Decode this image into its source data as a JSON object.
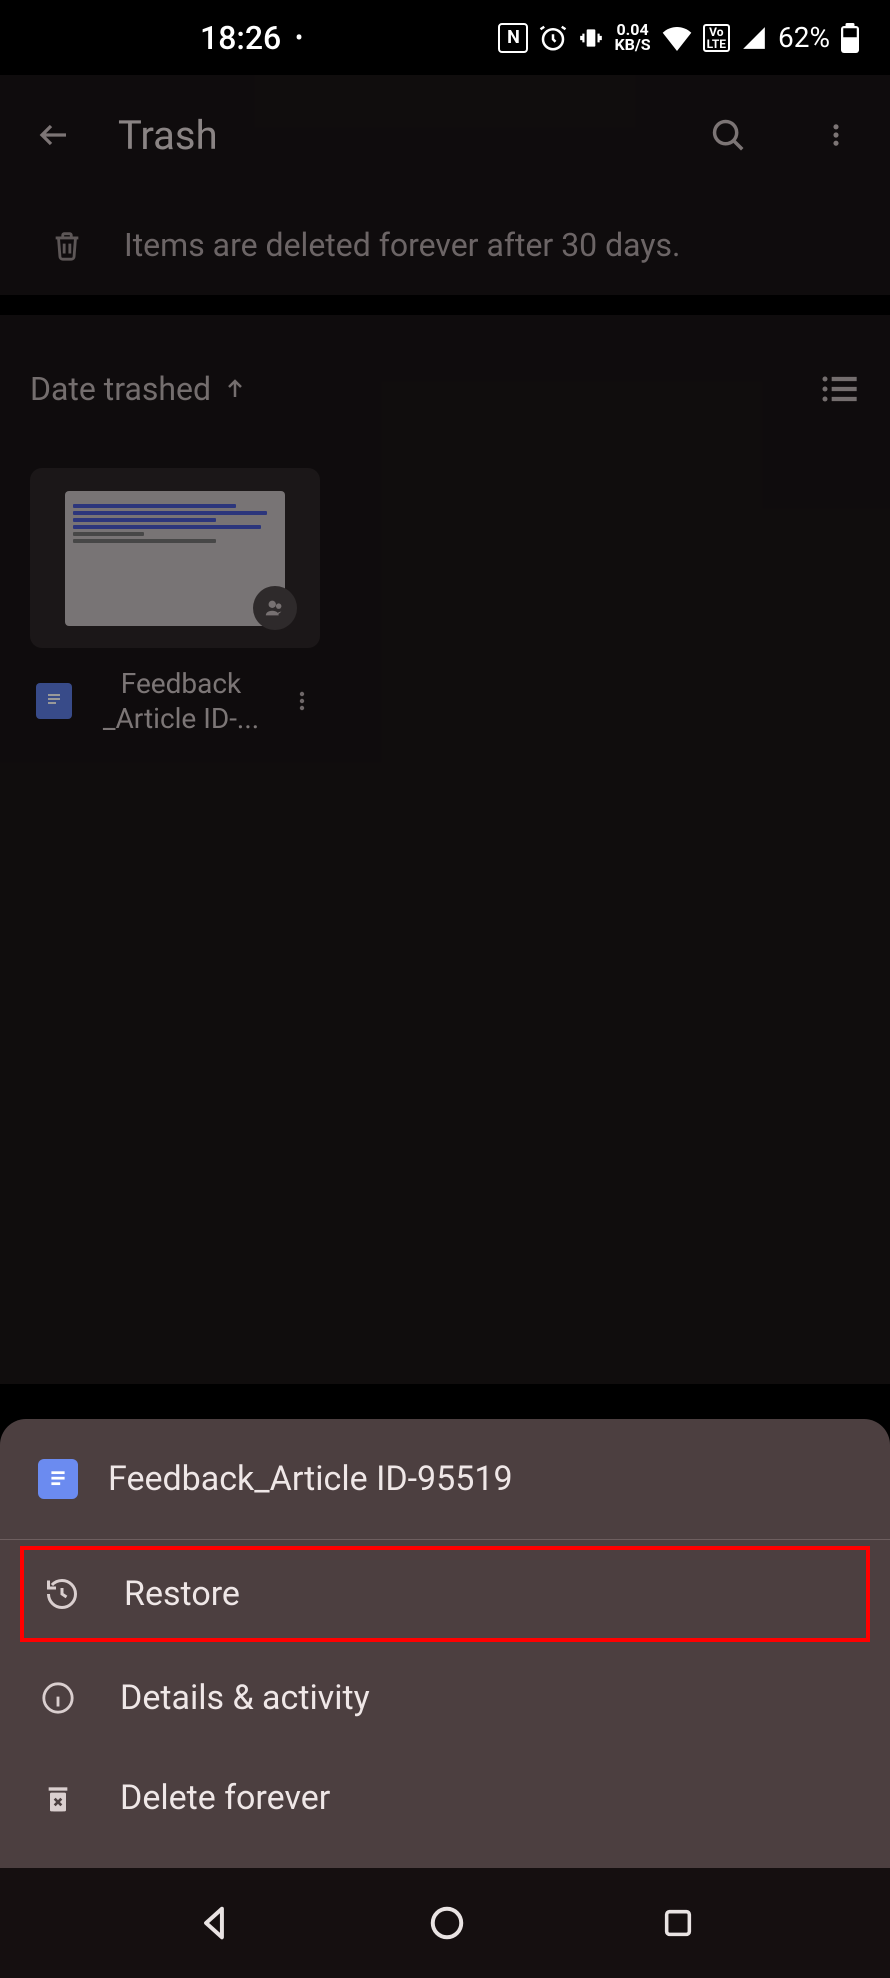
{
  "status": {
    "time": "18:26",
    "nfc_icon": "NFC",
    "data_rate_top": "0.04",
    "data_rate_bottom": "KB/S",
    "volte": "Vo LTE",
    "battery_pct": "62%"
  },
  "header": {
    "title": "Trash"
  },
  "banner": {
    "text": "Items are deleted forever after 30 days."
  },
  "sort": {
    "label": "Date trashed"
  },
  "file": {
    "name_line1": "Feedback",
    "name_line2": "_Article ID-..."
  },
  "sheet": {
    "title": "Feedback_Article ID-95519",
    "items": {
      "restore": "Restore",
      "details": "Details & activity",
      "delete": "Delete forever"
    }
  }
}
